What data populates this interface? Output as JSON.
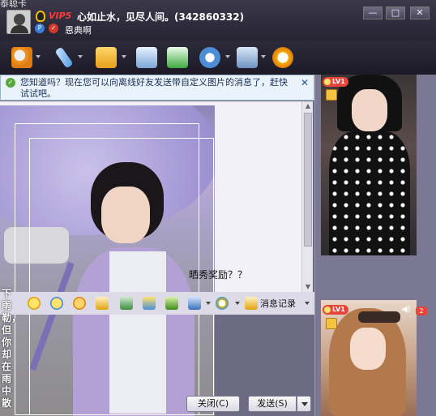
{
  "window": {
    "cut_title": "泰聪卡",
    "vip": "VIP5",
    "status": "心如止水，见尽人间。(342860332)",
    "nickname": "恩典啊",
    "controls": [
      "—",
      "□",
      "✕"
    ]
  },
  "toolbar": {
    "icons": [
      "webcam-icon",
      "microphone-icon",
      "send-file-icon",
      "mailbox-icon",
      "add-app-icon",
      "remote-assist-icon",
      "settings-icon",
      "qq-game-icon"
    ]
  },
  "notice": {
    "text": "您知道吗？现在您可以向离线好友发送带自定义图片的消息了，赶快试试吧。",
    "close": "✕"
  },
  "chat": {
    "message": "晒秀奖励？？"
  },
  "format_bar": {
    "icons": [
      "font-icon",
      "emoticon-icon",
      "magic-emoticon-icon",
      "shake-icon",
      "picture-icon",
      "music-icon",
      "screenshot-icon",
      "theme-icon",
      "qq-show-icon"
    ],
    "history_label": "消息记录"
  },
  "input": {
    "side_text": "下雨勒，但你却在雨中散"
  },
  "buttons": {
    "close": "关闭(C)",
    "send": "发送(S)"
  },
  "right_panel": {
    "level_top": "LV1",
    "level_bottom": "LV1",
    "count": "2"
  },
  "colors": {
    "accent_red": "#e6453c",
    "title_bg": "#2b2938",
    "notice_bg": "#eaf3fb"
  }
}
